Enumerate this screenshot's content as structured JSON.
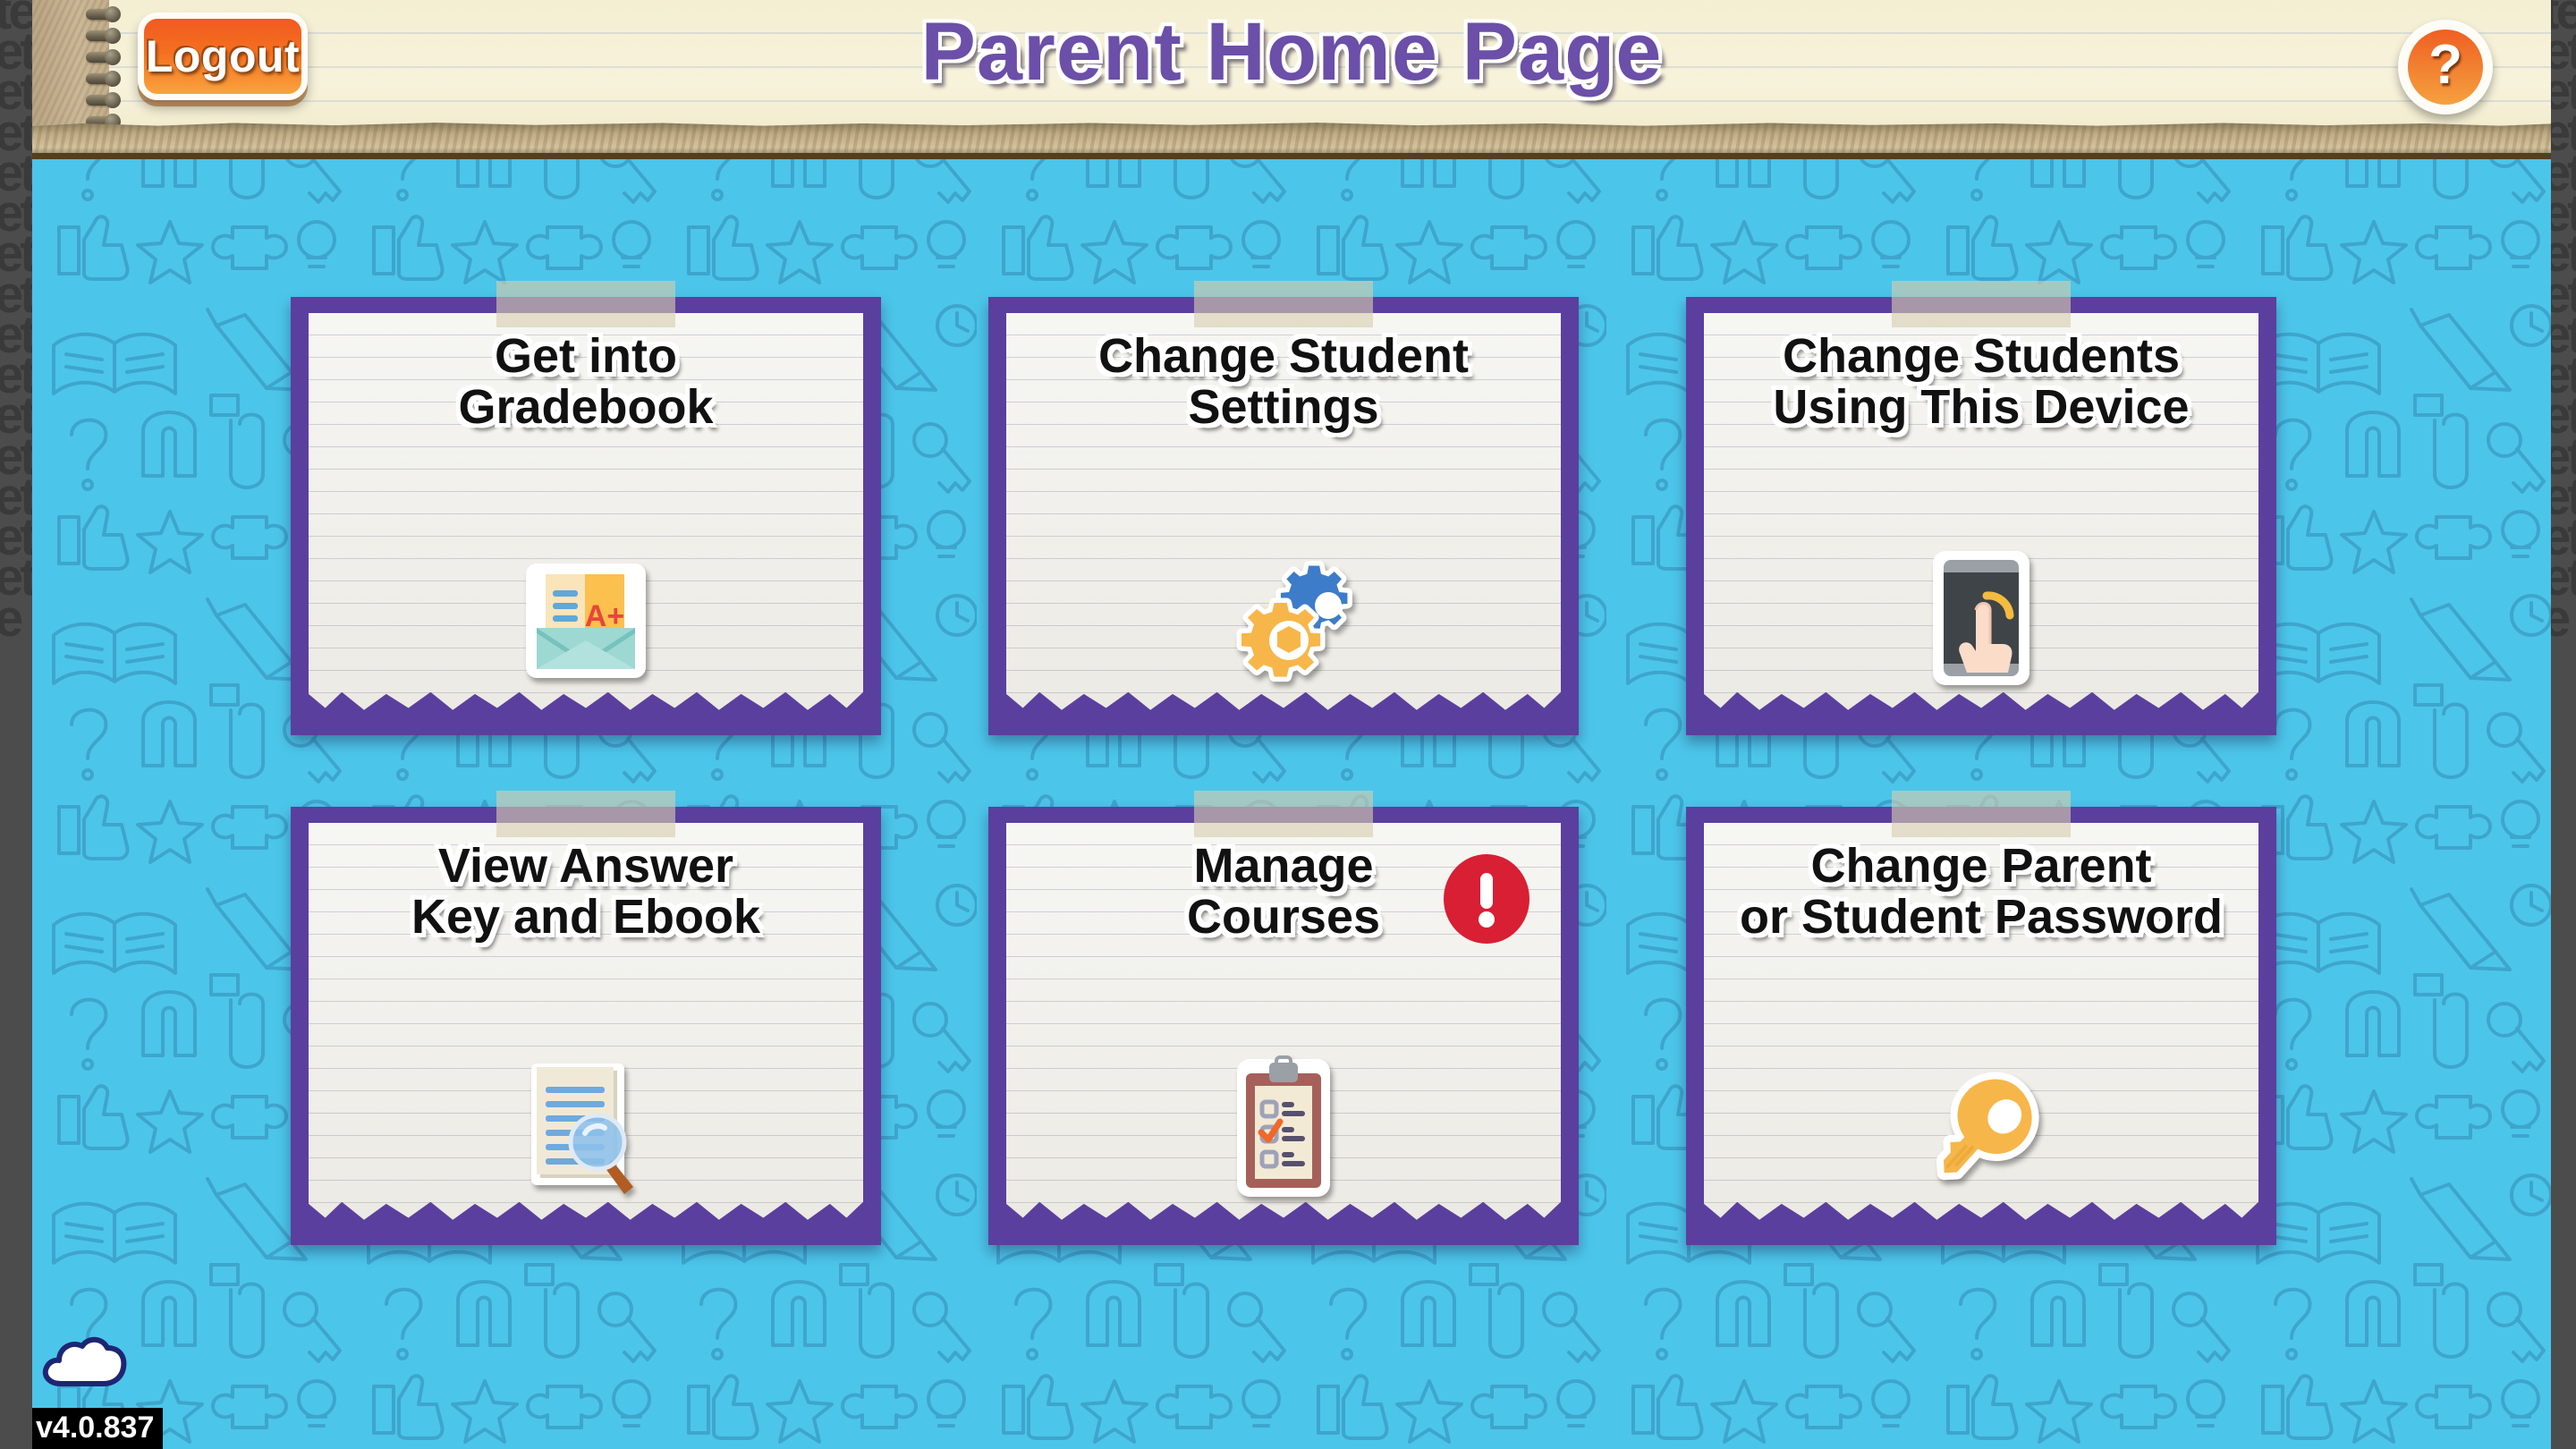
{
  "header": {
    "title": "Parent Home Page",
    "logout_label": "Logout",
    "help_label": "?"
  },
  "footer": {
    "version": "v4.0.837",
    "cloud_icon": "cloud-icon"
  },
  "colors": {
    "background_blue": "#4cc5ea",
    "doodle_stroke": "#3a86ae",
    "card_border_purple": "#5b3f9e",
    "paper": "#f6f6f3",
    "title_purple": "#6b4fa8",
    "logout_orange": "#f4701f",
    "alert_red": "#d81f34",
    "key_yellow": "#f7b64a",
    "letterbox_gray": "#4c4c4c"
  },
  "letterbox": {
    "left_text": "tetetetetetetetetetetetetetetete",
    "right_text": "tetetetetetetetetetetetetetetete"
  },
  "cards": [
    {
      "title": "Get into\nGradebook",
      "icon": "gradebook-envelope-icon",
      "badge": null
    },
    {
      "title": "Change Student\nSettings",
      "icon": "gears-icon",
      "badge": null
    },
    {
      "title": "Change Students\nUsing This Device",
      "icon": "tablet-tap-icon",
      "badge": null
    },
    {
      "title": "View Answer\nKey and Ebook",
      "icon": "document-magnifier-icon",
      "badge": null
    },
    {
      "title": "Manage\nCourses",
      "icon": "clipboard-checklist-icon",
      "badge": "!"
    },
    {
      "title": "Change Parent\nor Student Password",
      "icon": "key-icon",
      "badge": null
    }
  ]
}
